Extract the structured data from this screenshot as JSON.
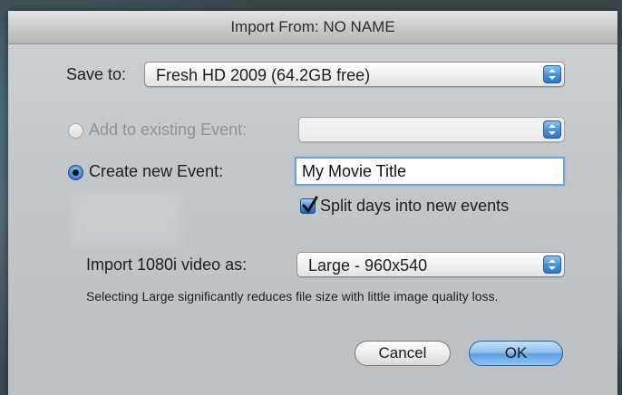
{
  "dialog": {
    "title": "Import From: NO NAME"
  },
  "save_to": {
    "label": "Save to:",
    "value": "Fresh HD 2009 (64.2GB free)"
  },
  "existing_event": {
    "label": "Add to existing Event:",
    "value": "",
    "selected": false,
    "enabled": false
  },
  "new_event": {
    "label": "Create new Event:",
    "value": "My Movie Title",
    "selected": true
  },
  "split_days": {
    "label": "Split days into new events",
    "checked": true
  },
  "import_size": {
    "label": "Import 1080i video as:",
    "value": "Large - 960x540",
    "note": "Selecting Large significantly reduces file size with little image quality loss."
  },
  "buttons": {
    "cancel": "Cancel",
    "ok": "OK"
  },
  "colors": {
    "accent": "#4d93d8",
    "default_button": "#8ec0ef"
  }
}
